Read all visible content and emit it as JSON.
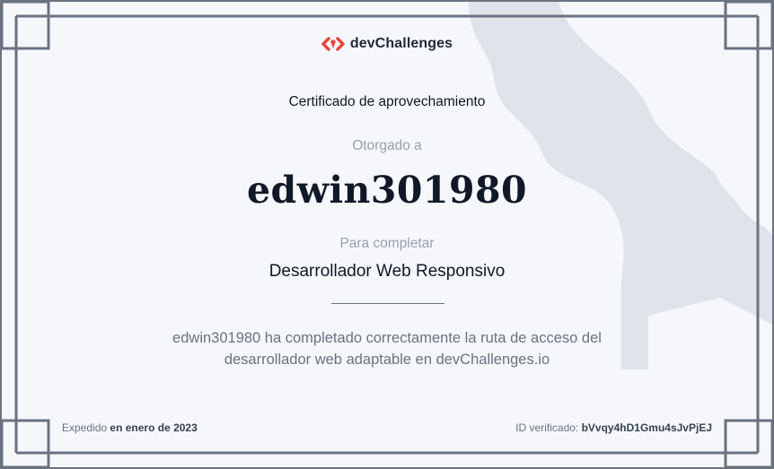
{
  "brand": {
    "logo_text": "devChallenges",
    "accent_color": "#e8453c",
    "icon": "dev-challenges-logo-icon"
  },
  "certificate": {
    "title": "Certificado de aprovechamiento",
    "granted_label": "Otorgado a",
    "recipient": "edwin301980",
    "complete_label": "Para completar",
    "course": "Desarrollador Web Responsivo",
    "description_line1": "edwin301980 ha completado correctamente la ruta de acceso del",
    "description_line2": "desarrollador web adaptable en devChallenges.io"
  },
  "footer": {
    "issued_prefix": "Expedido",
    "issued_date": "en enero de 2023",
    "verified_prefix": "ID verificado:",
    "verified_id": "bVvqy4hD1Gmu4sJvPjEJ"
  },
  "colors": {
    "background": "#f5f7fb",
    "frame": "#6b7280",
    "badge": "#dfe3ea",
    "text_dark": "#111827",
    "text_muted": "#9aa1ae"
  }
}
